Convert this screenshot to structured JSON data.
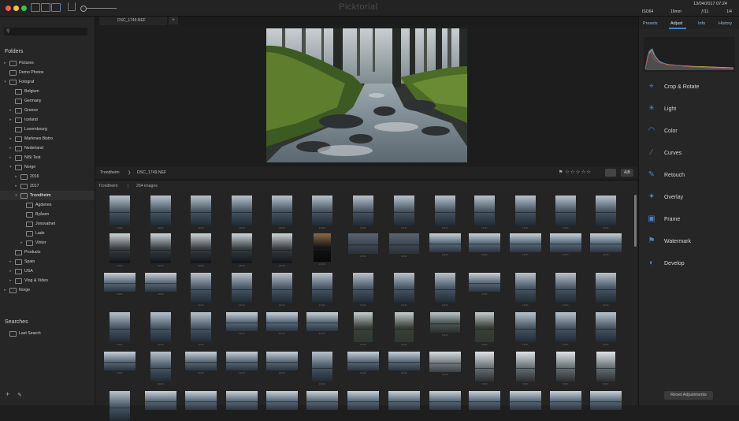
{
  "app": {
    "title": "Picktorial"
  },
  "titlebar": {
    "date_time": "13/04/2017 07:24",
    "iso": "ISO64",
    "focal": "16mm",
    "aperture": "ƒ/11",
    "shutter": "1/4"
  },
  "sidebar": {
    "folders_heading": "Folders",
    "searches_heading": "Searches",
    "folders": [
      {
        "label": "Pictures",
        "depth": 0,
        "arrow": "▸"
      },
      {
        "label": "Demo Photos",
        "depth": 0,
        "arrow": ""
      },
      {
        "label": "Fotograf",
        "depth": 0,
        "arrow": "▾"
      },
      {
        "label": "Belgium",
        "depth": 1,
        "arrow": ""
      },
      {
        "label": "Germany",
        "depth": 1,
        "arrow": ""
      },
      {
        "label": "Greece",
        "depth": 1,
        "arrow": "▸"
      },
      {
        "label": "Iceland",
        "depth": 1,
        "arrow": "▸"
      },
      {
        "label": "Luxembourg",
        "depth": 1,
        "arrow": ""
      },
      {
        "label": "Marlenes Bistro",
        "depth": 1,
        "arrow": "▸"
      },
      {
        "label": "Nederland",
        "depth": 1,
        "arrow": "▸"
      },
      {
        "label": "NiSi Test",
        "depth": 1,
        "arrow": "▸"
      },
      {
        "label": "Norge",
        "depth": 1,
        "arrow": "▾"
      },
      {
        "label": "2016",
        "depth": 2,
        "arrow": "▸"
      },
      {
        "label": "2017",
        "depth": 2,
        "arrow": "▸"
      },
      {
        "label": "Trondheim",
        "depth": 2,
        "arrow": "▾",
        "selected": true
      },
      {
        "label": "Agdenes",
        "depth": 3,
        "arrow": ""
      },
      {
        "label": "Byåsen",
        "depth": 3,
        "arrow": ""
      },
      {
        "label": "Jonsvatnet",
        "depth": 3,
        "arrow": ""
      },
      {
        "label": "Lade",
        "depth": 3,
        "arrow": ""
      },
      {
        "label": "Vinter",
        "depth": 3,
        "arrow": "▸"
      },
      {
        "label": "Products",
        "depth": 1,
        "arrow": ""
      },
      {
        "label": "Spain",
        "depth": 1,
        "arrow": "▸"
      },
      {
        "label": "USA",
        "depth": 1,
        "arrow": "▸"
      },
      {
        "label": "Vlog & Video",
        "depth": 1,
        "arrow": "▸"
      },
      {
        "label": "Norge",
        "depth": 0,
        "arrow": "▸"
      }
    ],
    "searches": [
      {
        "label": "Last Search"
      }
    ],
    "footer": {
      "add": "+",
      "edit": "✎"
    }
  },
  "center": {
    "tab_label": "DSC_1749.NEF",
    "tab_add": "+",
    "breadcrumb": {
      "folder": "Trondheim",
      "sep": "❯",
      "file": "DSC_1749.NEF"
    },
    "rating_stars": "☆☆☆☆☆",
    "compare_label": "A|B",
    "grid_folder": "Trondheim",
    "grid_sep": "|",
    "grid_count": "264 images",
    "thumb_dots": "•••••"
  },
  "right_panel": {
    "tabs": [
      "Presets",
      "Adjust",
      "Info",
      "History"
    ],
    "active_tab": "Adjust",
    "tools": [
      {
        "label": "Crop & Rotate",
        "icon": "crop-icon",
        "glyph": "⌖"
      },
      {
        "label": "Light",
        "icon": "light-icon",
        "glyph": "☀"
      },
      {
        "label": "Color",
        "icon": "color-icon",
        "glyph": "◠"
      },
      {
        "label": "Curves",
        "icon": "curves-icon",
        "glyph": "∕"
      },
      {
        "label": "Retouch",
        "icon": "retouch-icon",
        "glyph": "✎"
      },
      {
        "label": "Overlay",
        "icon": "overlay-icon",
        "glyph": "✦"
      },
      {
        "label": "Frame",
        "icon": "frame-icon",
        "glyph": "▣"
      },
      {
        "label": "Watermark",
        "icon": "watermark-icon",
        "glyph": "⚑"
      },
      {
        "label": "Develop",
        "icon": "develop-icon",
        "glyph": "◐"
      }
    ],
    "reset_label": "Reset Adjustments"
  },
  "colors": {
    "accent": "#4b82c4",
    "traffic_red": "#fc5c57",
    "traffic_yellow": "#fdbc40",
    "traffic_green": "#33c748"
  }
}
